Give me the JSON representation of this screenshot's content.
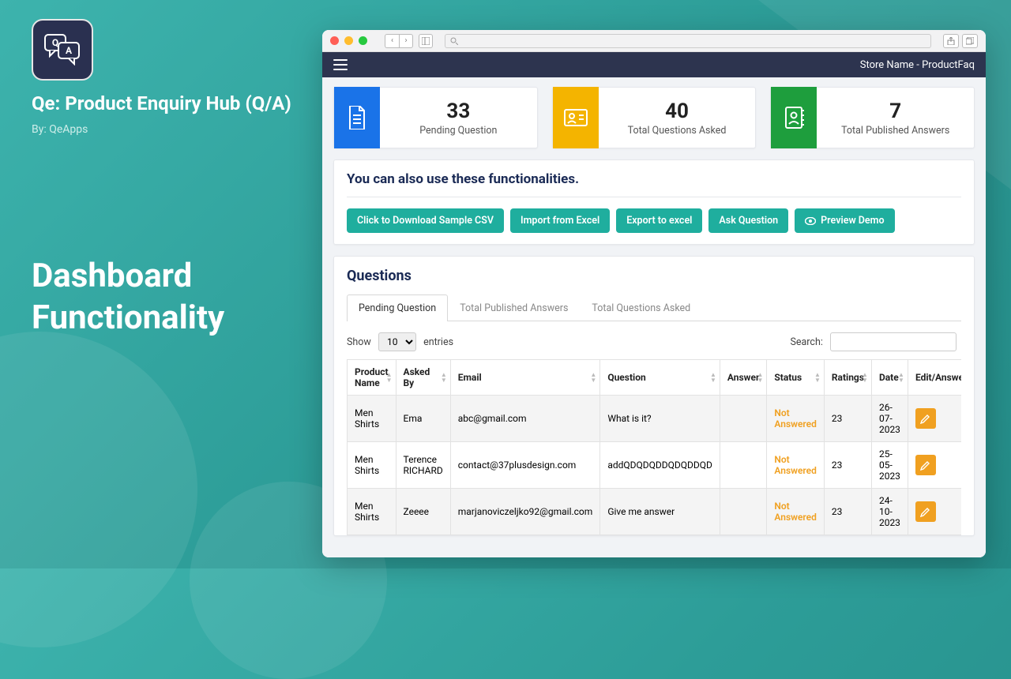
{
  "left": {
    "title": "Qe: Product Enquiry Hub (Q/A)",
    "by": "By: QeApps",
    "headline1": "Dashboard",
    "headline2": "Functionality"
  },
  "browser": {
    "search_placeholder": ""
  },
  "appbar": {
    "store": "Store Name - ProductFaq"
  },
  "stats": [
    {
      "value": "33",
      "label": "Pending Question",
      "color": "#1a73e8",
      "icon": "file-icon"
    },
    {
      "value": "40",
      "label": "Total Questions Asked",
      "color": "#f4b400",
      "icon": "id-card-icon"
    },
    {
      "value": "7",
      "label": "Total Published Answers",
      "color": "#1e9e3d",
      "icon": "contacts-icon"
    }
  ],
  "func": {
    "heading": "You can also use these functionalities.",
    "buttons": [
      "Click to Download Sample CSV",
      "Import from Excel",
      "Export to excel",
      "Ask Question",
      "Preview Demo"
    ]
  },
  "questions": {
    "heading": "Questions",
    "tabs": [
      "Pending Question",
      "Total Published Answers",
      "Total Questions Asked"
    ],
    "active_tab": "Pending Question",
    "show_label": "Show",
    "entries_label": "entries",
    "page_size": "10",
    "search_label": "Search:",
    "columns": [
      "Product Name",
      "Asked By",
      "Email",
      "Question",
      "Answer",
      "Status",
      "Ratings",
      "Date",
      "Edit/Answer"
    ],
    "rows": [
      {
        "product": "Men Shirts",
        "by": "Ema",
        "email": "abc@gmail.com",
        "question": "What is it?",
        "answer": "",
        "status": "Not Answered",
        "ratings": "23",
        "date": "26-07-2023"
      },
      {
        "product": "Men Shirts",
        "by": "Terence RICHARD",
        "email": "contact@37plusdesign.com",
        "question": "addQDQDQDDQDQDDQD",
        "answer": "",
        "status": "Not Answered",
        "ratings": "23",
        "date": "25-05-2023"
      },
      {
        "product": "Men Shirts",
        "by": "Zeeee",
        "email": "marjanoviczeljko92@gmail.com",
        "question": "Give me answer",
        "answer": "",
        "status": "Not Answered",
        "ratings": "23",
        "date": "24-10-2023"
      }
    ]
  }
}
